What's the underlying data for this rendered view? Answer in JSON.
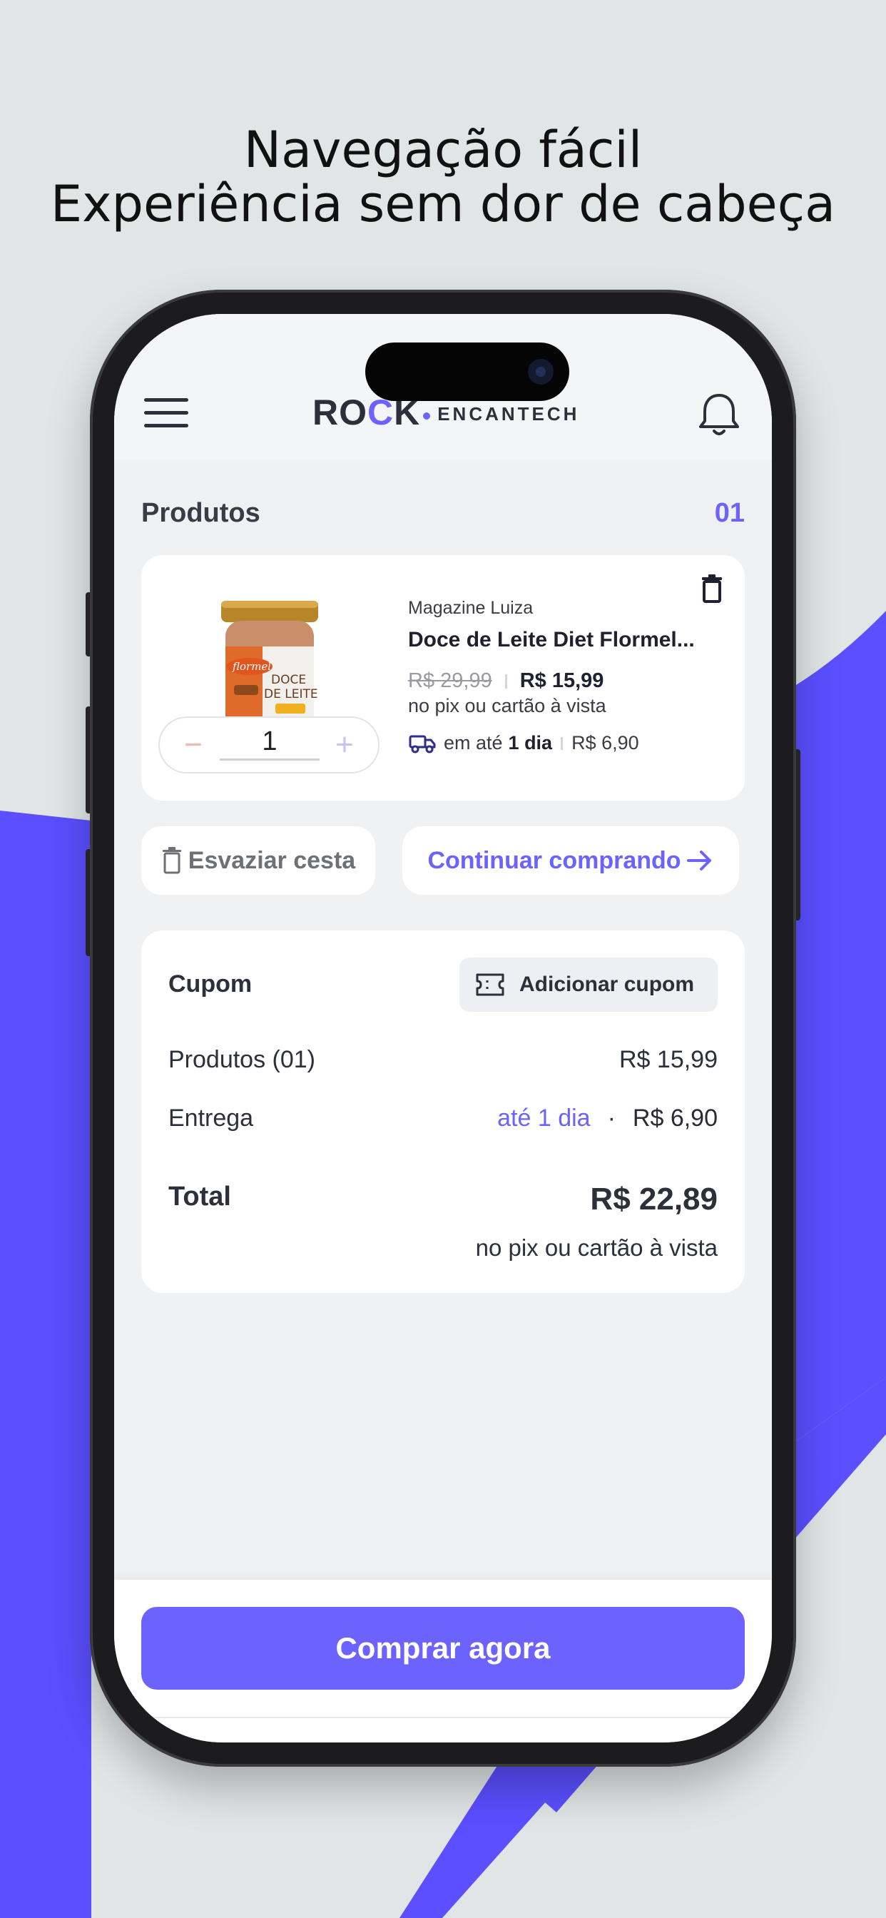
{
  "headline": {
    "line1": "Navegação fácil",
    "line2": "Experiência sem dor de cabeça"
  },
  "colors": {
    "accent": "#6c63ff",
    "background": "#e1e5e6",
    "purple_shape": "#5b4fff"
  },
  "header": {
    "logo_main_prefix": "RO",
    "logo_main_accent": "C",
    "logo_main_suffix": "K",
    "logo_sub": "ENCANTECH",
    "menu_icon": "hamburger-icon",
    "notification_icon": "bell-icon"
  },
  "products_section": {
    "title": "Produtos",
    "count": "01"
  },
  "product": {
    "image_icon": "product-jar-image",
    "seller": "Magazine Luiza",
    "name": "Doce de Leite Diet Flormel...",
    "old_price": "R$ 29,99",
    "new_price": "R$ 15,99",
    "payment_note": "no pix ou cartão à vista",
    "delivery_prefix": "em até",
    "delivery_time": "1 dia",
    "delivery_price": "R$ 6,90",
    "quantity": "1",
    "minus_label": "−",
    "plus_label": "+"
  },
  "actions": {
    "empty_cart": "Esvaziar cesta",
    "continue_shopping": "Continuar comprando"
  },
  "summary": {
    "coupon_label": "Cupom",
    "add_coupon": "Adicionar cupom",
    "products_label": "Produtos (01)",
    "products_value": "R$ 15,99",
    "delivery_label": "Entrega",
    "delivery_time": "até 1 dia",
    "delivery_dot": "·",
    "delivery_value": "R$ 6,90",
    "total_label": "Total",
    "total_value": "R$ 22,89",
    "total_note": "no pix ou cartão à vista"
  },
  "checkout": {
    "buy_now": "Comprar agora"
  }
}
